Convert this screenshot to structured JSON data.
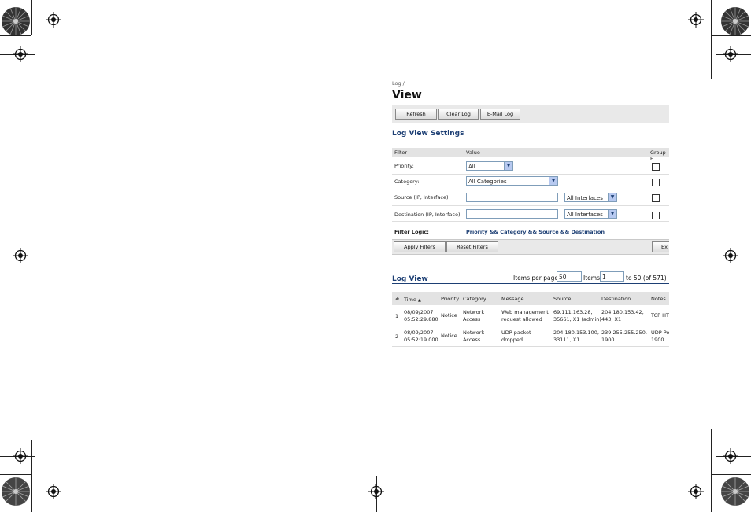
{
  "breadcrumb": "Log /",
  "page_title": "View",
  "toolbar": {
    "refresh_label": "Refresh",
    "clear_log_label": "Clear Log",
    "email_log_label": "E-Mail Log"
  },
  "log_view_settings": {
    "title": "Log View Settings",
    "headers": {
      "filter": "Filter",
      "value": "Value",
      "group": "Group F"
    },
    "priority": {
      "label": "Priority:",
      "value": "All"
    },
    "category": {
      "label": "Category:",
      "value": "All Categories"
    },
    "source": {
      "label": "Source (IP, Interface):",
      "interface": "All Interfaces"
    },
    "destination": {
      "label": "Destination (IP, Interface):",
      "interface": "All Interfaces"
    },
    "filter_logic": {
      "label": "Filter Logic:",
      "value": "Priority && Category && Source && Destination"
    },
    "apply_label": "Apply Filters",
    "reset_label": "Reset Filters",
    "export_label": "Ex"
  },
  "log_view": {
    "title": "Log View",
    "items_per_page_label": "Items per page",
    "items_per_page": "50",
    "items_label": "Items",
    "items_start": "1",
    "range_text": "to 50 (of 571)",
    "columns": {
      "num": "#",
      "time": "Time",
      "priority": "Priority",
      "category": "Category",
      "message": "Message",
      "source": "Source",
      "destination": "Destination",
      "notes": "Notes"
    },
    "sort_icon": "sort-ascending-icon",
    "rows": [
      {
        "num": "1",
        "time": "08/09/2007\n05:52:29.880",
        "priority": "Notice",
        "category": "Network\nAccess",
        "message": "Web management\nrequest allowed",
        "source": "69.111.163.28,\n35661, X1 (admin)",
        "destination": "204.180.153.42,\n443, X1",
        "notes": "TCP HT"
      },
      {
        "num": "2",
        "time": "08/09/2007\n05:52:19.000",
        "priority": "Notice",
        "category": "Network\nAccess",
        "message": "UDP packet\ndropped",
        "source": "204.180.153.100,\n33111, X1",
        "destination": "239.255.255.250,\n1900",
        "notes": "UDP Po\n1900"
      }
    ]
  },
  "colors": {
    "accent": "#1d3f74",
    "toolbar_bg": "#e9e9e9",
    "header_bg": "#e3e3e3",
    "input_border": "#7f9db9"
  }
}
